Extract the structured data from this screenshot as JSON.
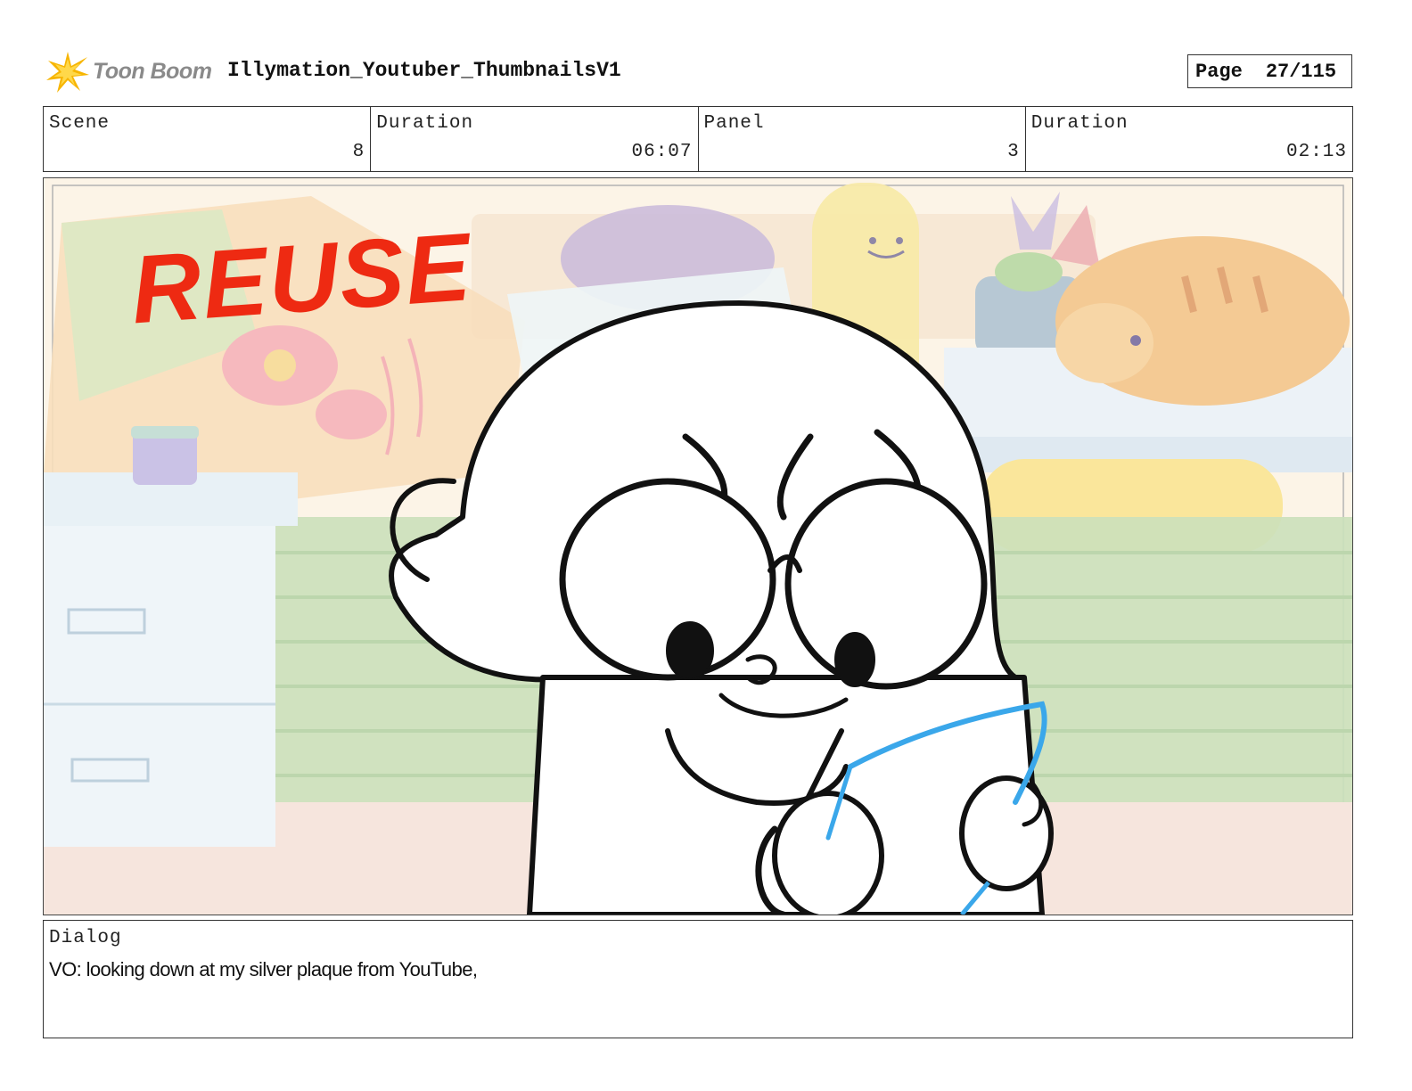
{
  "header": {
    "logo_text": "Toon Boom",
    "project_title": "Illymation_Youtuber_ThumbnailsV1",
    "page_label": "Page",
    "page_number": "27/115"
  },
  "info": {
    "scene_label": "Scene",
    "scene_value": "8",
    "scene_duration_label": "Duration",
    "scene_duration_value": "06:07",
    "panel_label": "Panel",
    "panel_value": "3",
    "panel_duration_label": "Duration",
    "panel_duration_value": "02:13"
  },
  "panel": {
    "overlay_text": "REUSE",
    "overlay_color": "#ee2a12",
    "tablet_color": "#3aa7ea"
  },
  "dialog": {
    "label": "Dialog",
    "text": "VO: looking down at my silver plaque from YouTube,"
  }
}
